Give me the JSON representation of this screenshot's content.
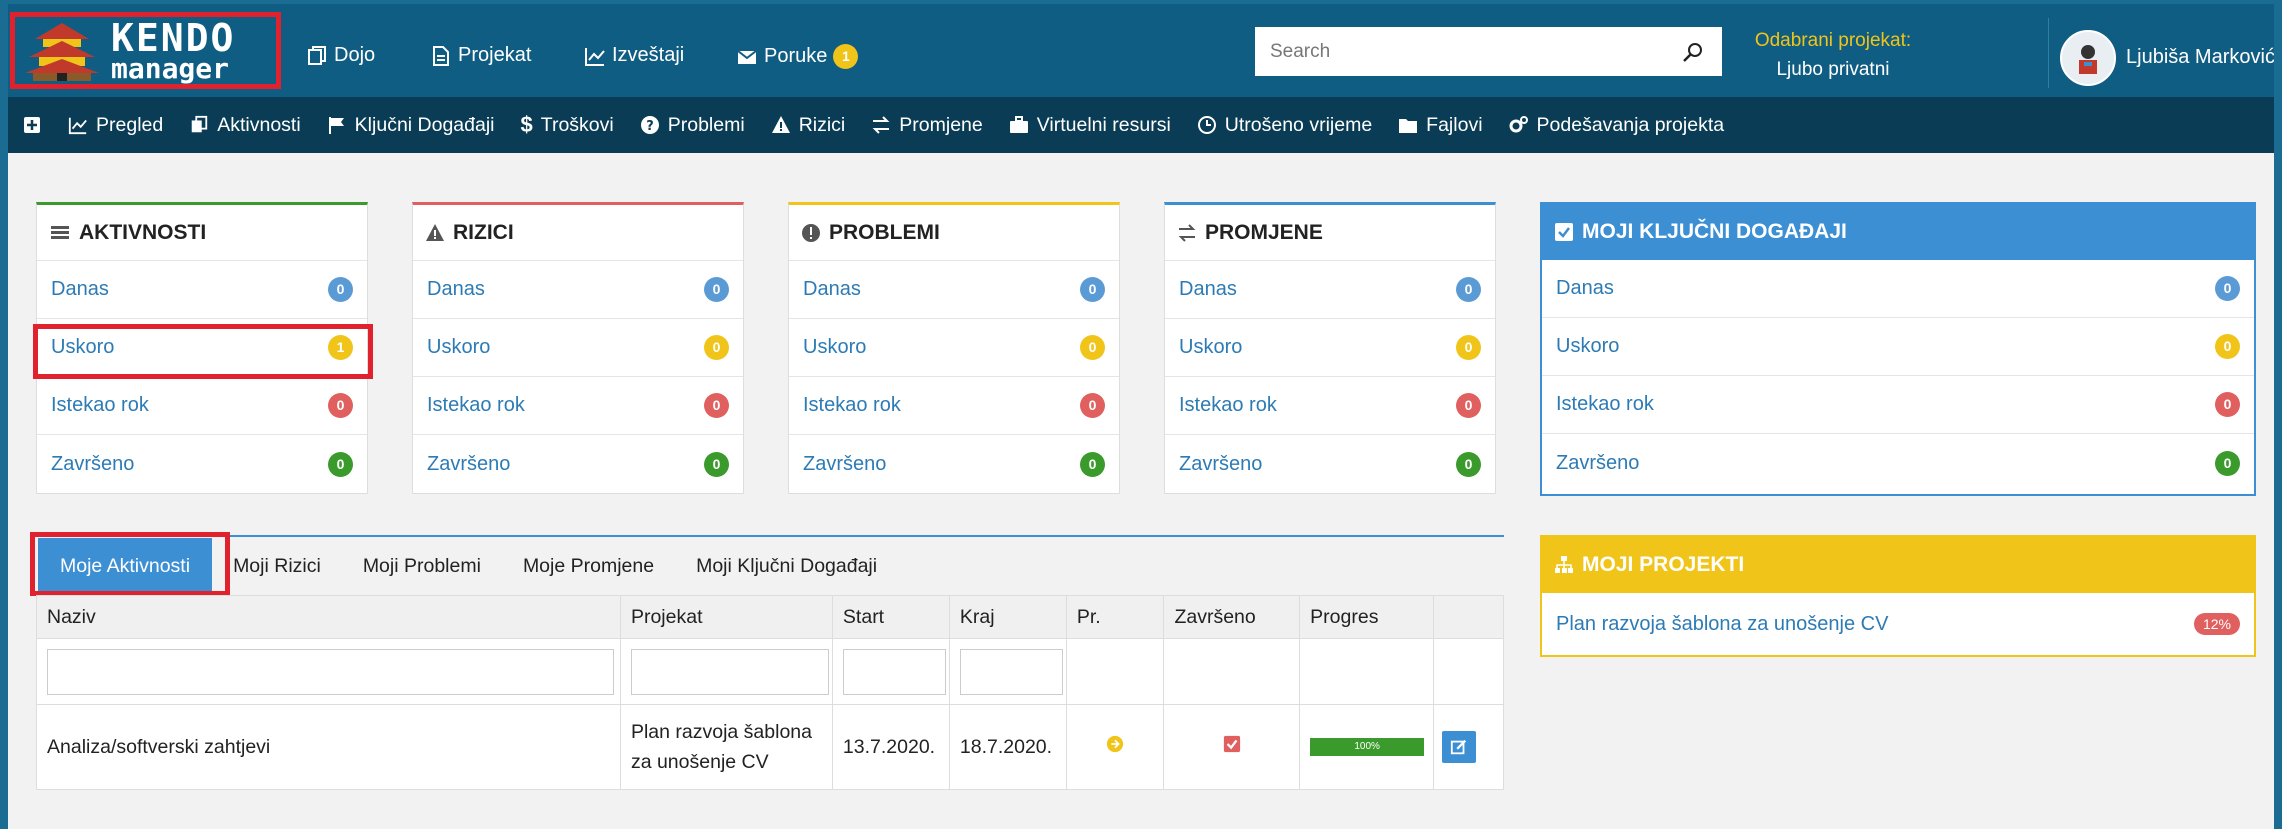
{
  "brand": {
    "line1": "KENDO",
    "line2": "manager"
  },
  "topnav": [
    {
      "label": "Dojo",
      "icon": "copy-icon"
    },
    {
      "label": "Projekat",
      "icon": "file-icon"
    },
    {
      "label": "Izveštaji",
      "icon": "chart-icon"
    },
    {
      "label": "Poruke",
      "icon": "envelope-icon",
      "badge": "1"
    }
  ],
  "search": {
    "placeholder": "Search"
  },
  "project": {
    "label": "Odabrani projekat:",
    "value": "Ljubo privatni"
  },
  "user": {
    "name": "Ljubiša Marković"
  },
  "subnav": [
    {
      "label": "",
      "icon": "plus-icon"
    },
    {
      "label": "Pregled",
      "icon": "chart-icon"
    },
    {
      "label": "Aktivnosti",
      "icon": "copy-icon"
    },
    {
      "label": "Ključni Događaji",
      "icon": "flag-icon"
    },
    {
      "label": "Troškovi",
      "icon": "dollar-icon"
    },
    {
      "label": "Problemi",
      "icon": "question-icon"
    },
    {
      "label": "Rizici",
      "icon": "warning-icon"
    },
    {
      "label": "Promjene",
      "icon": "exchange-icon"
    },
    {
      "label": "Virtuelni resursi",
      "icon": "briefcase-icon"
    },
    {
      "label": "Utrošeno vrijeme",
      "icon": "clock-icon"
    },
    {
      "label": "Fajlovi",
      "icon": "folder-icon"
    },
    {
      "label": "Podešavanja projekta",
      "icon": "gears-icon"
    }
  ],
  "panels": [
    {
      "title": "AKTIVNOSTI",
      "accent": "#3a9a2b",
      "icon": "list-icon",
      "rows": [
        {
          "label": "Danas",
          "count": "0"
        },
        {
          "label": "Uskoro",
          "count": "1"
        },
        {
          "label": "Istekao rok",
          "count": "0"
        },
        {
          "label": "Završeno",
          "count": "0"
        }
      ]
    },
    {
      "title": "RIZICI",
      "accent": "#e06060",
      "icon": "warning-icon",
      "rows": [
        {
          "label": "Danas",
          "count": "0"
        },
        {
          "label": "Uskoro",
          "count": "0"
        },
        {
          "label": "Istekao rok",
          "count": "0"
        },
        {
          "label": "Završeno",
          "count": "0"
        }
      ]
    },
    {
      "title": "PROBLEMI",
      "accent": "#f0c419",
      "icon": "exclamation-icon",
      "rows": [
        {
          "label": "Danas",
          "count": "0"
        },
        {
          "label": "Uskoro",
          "count": "0"
        },
        {
          "label": "Istekao rok",
          "count": "0"
        },
        {
          "label": "Završeno",
          "count": "0"
        }
      ]
    },
    {
      "title": "PROMJENE",
      "accent": "#3d8fd4",
      "icon": "exchange-icon",
      "rows": [
        {
          "label": "Danas",
          "count": "0"
        },
        {
          "label": "Uskoro",
          "count": "0"
        },
        {
          "label": "Istekao rok",
          "count": "0"
        },
        {
          "label": "Završeno",
          "count": "0"
        }
      ]
    }
  ],
  "events_panel": {
    "title": "MOJI KLJUČNI DOGAĐAJI",
    "rows": [
      {
        "label": "Danas",
        "count": "0"
      },
      {
        "label": "Uskoro",
        "count": "0"
      },
      {
        "label": "Istekao rok",
        "count": "0"
      },
      {
        "label": "Završeno",
        "count": "0"
      }
    ]
  },
  "projects_panel": {
    "title": "MOJI PROJEKTI",
    "item": "Plan razvoja šablona za unošenje CV",
    "percent": "12%"
  },
  "tabs": [
    "Moje Aktivnosti",
    "Moji Rizici",
    "Moji Problemi",
    "Moje Promjene",
    "Moji Ključni Događaji"
  ],
  "table": {
    "columns": [
      "Naziv",
      "Projekat",
      "Start",
      "Kraj",
      "Pr.",
      "Završeno",
      "Progres",
      ""
    ],
    "rows": [
      {
        "naziv": "Analiza/softverski zahtjevi",
        "projekat_l1": "Plan razvoja šablona",
        "projekat_l2": "za unošenje CV",
        "start": "13.7.2020.",
        "kraj": "18.7.2020.",
        "progres": "100%"
      }
    ]
  },
  "colors": {
    "topbar": "#105d83",
    "subbar": "#0a3d55",
    "accent_blue": "#3d8fd4",
    "accent_yellow": "#f0c419",
    "highlight": "#e0222e"
  }
}
